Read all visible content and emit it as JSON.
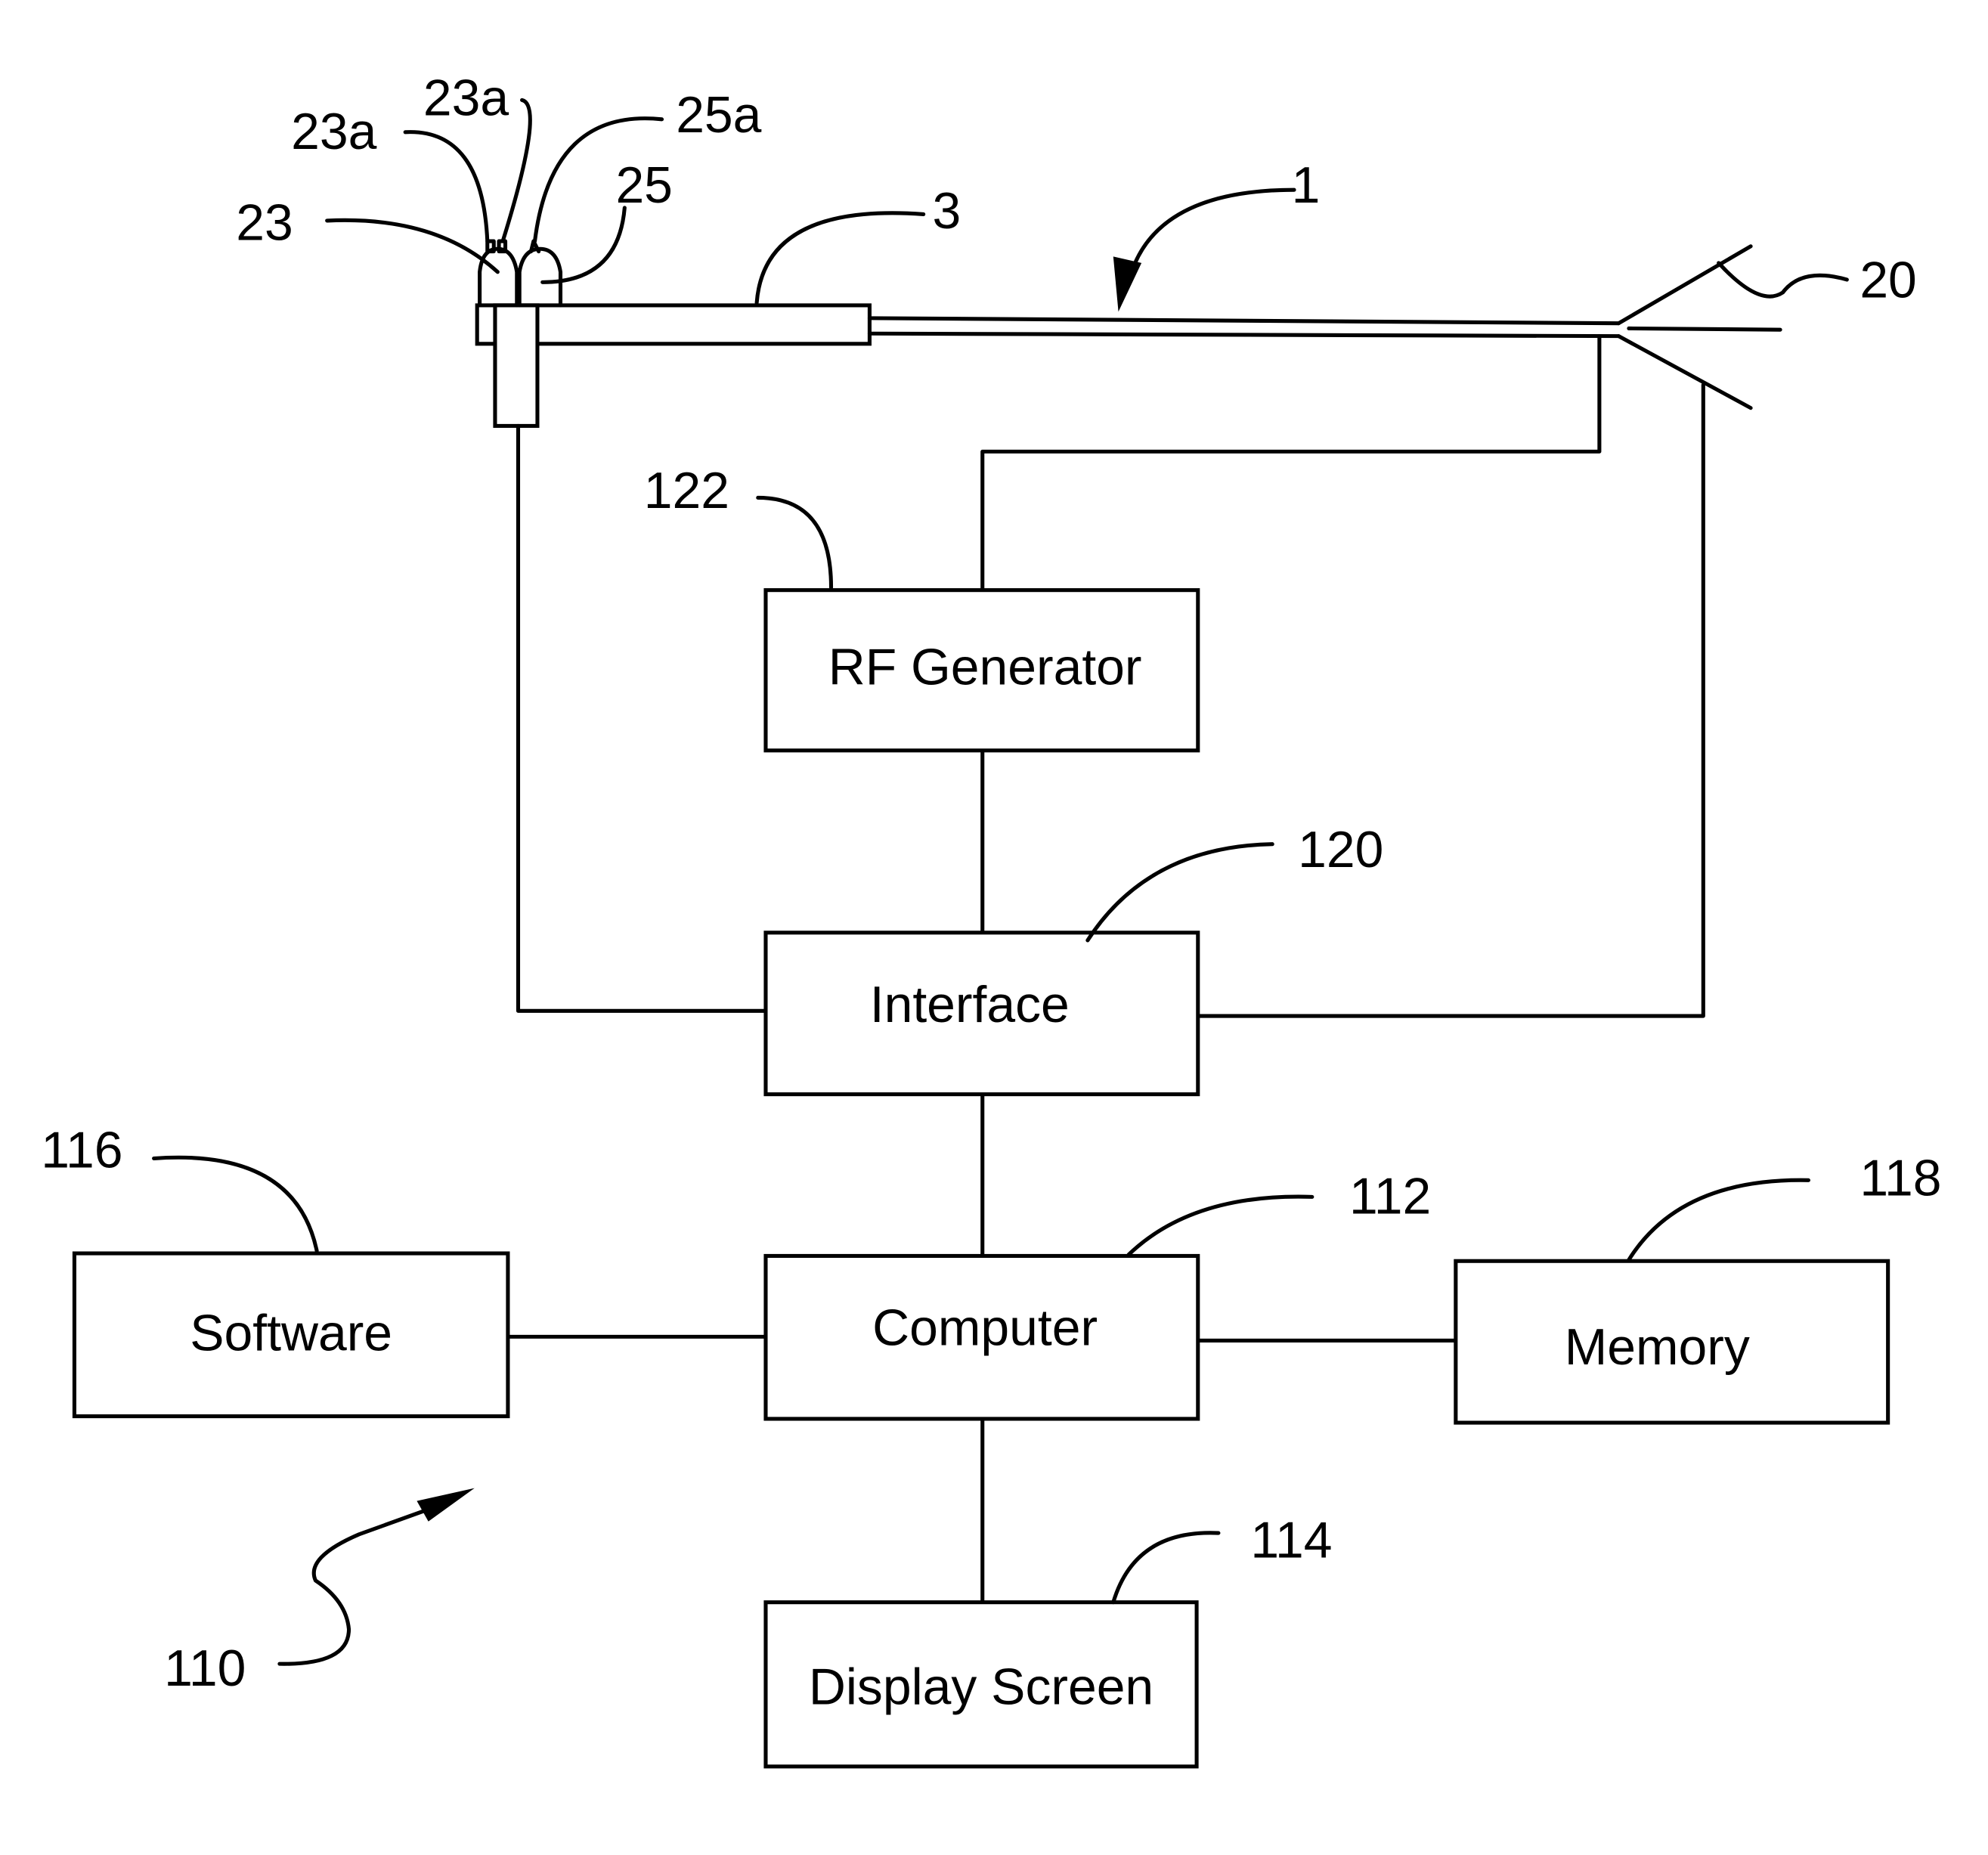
{
  "figure": {
    "blocks": {
      "rf_generator": {
        "label": "RF Generator",
        "ref": "122"
      },
      "interface": {
        "label": "Interface",
        "ref": "120"
      },
      "computer": {
        "label": "Computer",
        "ref": "112"
      },
      "software": {
        "label": "Software",
        "ref": "116"
      },
      "memory": {
        "label": "Memory",
        "ref": "118"
      },
      "display_screen": {
        "label": "Display Screen",
        "ref": "114"
      }
    },
    "device_refs": {
      "device": "1",
      "handle": "3",
      "tines": "20",
      "button_23": "23",
      "button_25": "25",
      "contact_23a_left": "23a",
      "contact_23a_right": "23a",
      "contact_25a": "25a"
    },
    "system_ref": "110"
  }
}
